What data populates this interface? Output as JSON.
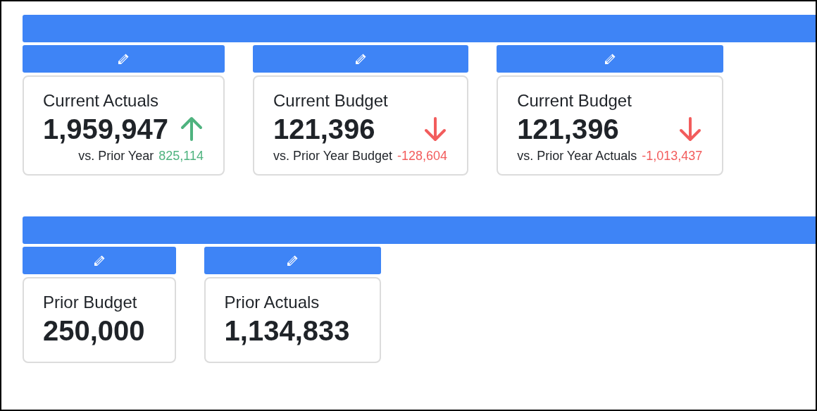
{
  "sections": [
    {
      "tiles": [
        {
          "title": "Current Actuals",
          "value": "1,959,947",
          "kind": "up",
          "comparison": {
            "label": "vs. Prior Year",
            "delta": "825,114"
          }
        },
        {
          "title": "Current Budget",
          "value": "121,396",
          "kind": "down",
          "comparison": {
            "label": "vs. Prior Year Budget",
            "delta": "-128,604"
          }
        },
        {
          "title": "Current Budget",
          "value": "121,396",
          "kind": "down",
          "comparison": {
            "label": "vs. Prior Year Actuals",
            "delta": "-1,013,437"
          }
        }
      ]
    },
    {
      "tiles": [
        {
          "title": "Prior Budget",
          "value": "250,000"
        },
        {
          "title": "Prior Actuals",
          "value": "1,134,833"
        }
      ]
    }
  ]
}
